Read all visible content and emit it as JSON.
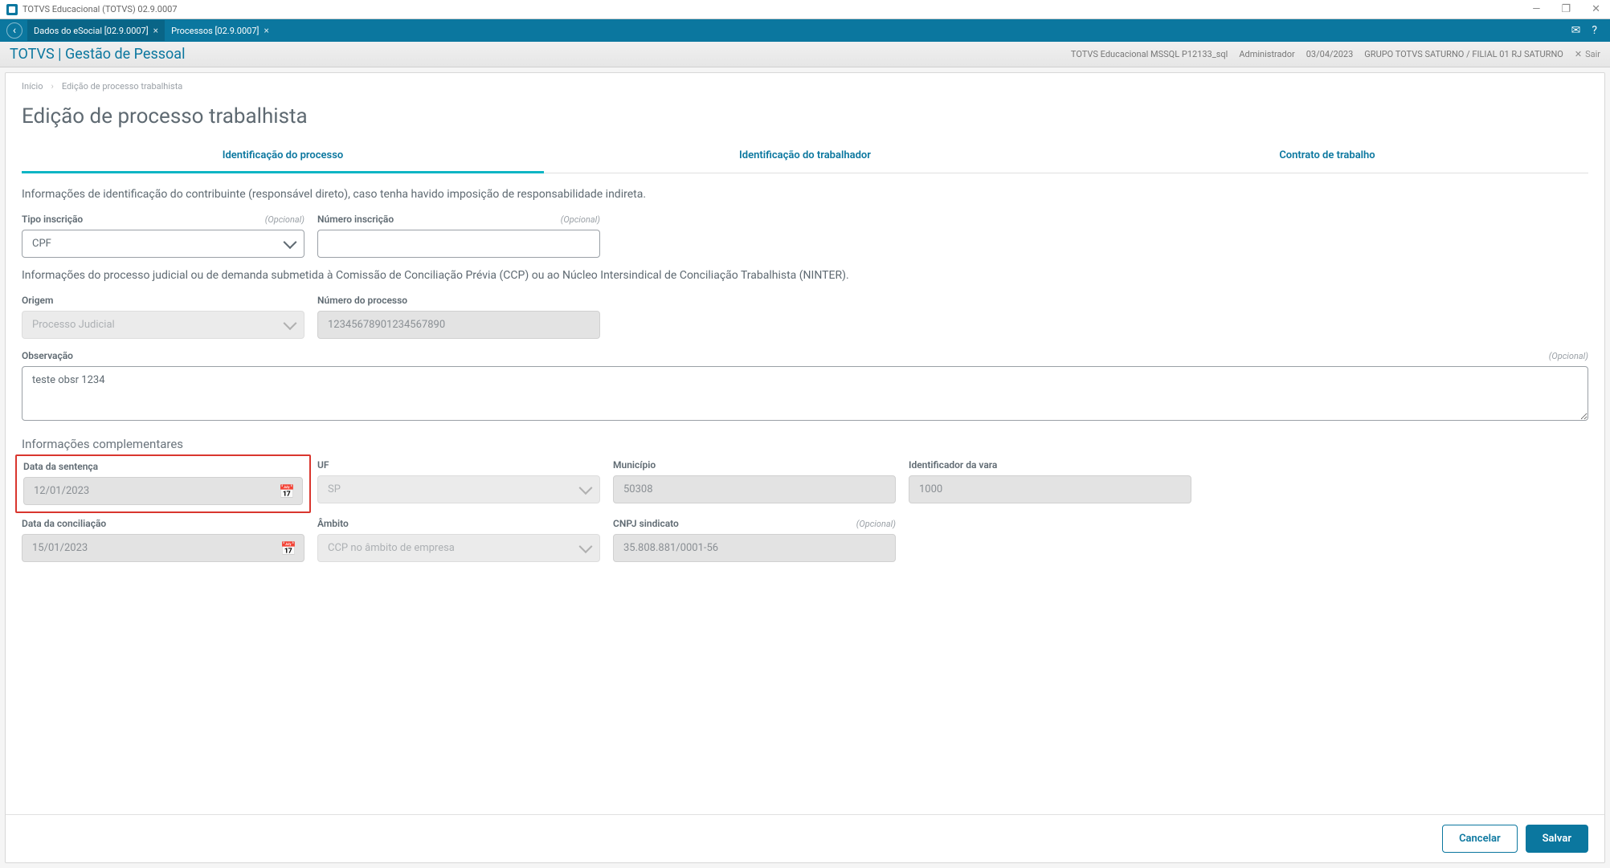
{
  "window": {
    "title": "TOTVS Educacional (TOTVS) 02.9.0007",
    "minimize": "—",
    "maximize": "❐",
    "close": "✕"
  },
  "tabbar": {
    "tabs": [
      {
        "label": "Dados do eSocial [02.9.0007]"
      },
      {
        "label": "Processos [02.9.0007]"
      }
    ]
  },
  "header": {
    "brand": "TOTVS | Gestão de Pessoal",
    "env": "TOTVS Educacional MSSQL P12133_sql",
    "user": "Administrador",
    "date": "03/04/2023",
    "company": "GRUPO TOTVS SATURNO / FILIAL 01 RJ SATURNO",
    "exit": "Sair"
  },
  "breadcrumb": {
    "home": "Início",
    "page": "Edição de processo trabalhista"
  },
  "page_title": "Edição de processo trabalhista",
  "tabs": {
    "t1": "Identificação do processo",
    "t2": "Identificação do trabalhador",
    "t3": "Contrato de trabalho"
  },
  "form": {
    "desc1": "Informações de identificação do contribuinte (responsável direto), caso tenha havido imposição de responsabilidade indireta.",
    "tipo_inscricao": {
      "label": "Tipo inscrição",
      "optional": "(Opcional)",
      "value": "CPF"
    },
    "numero_inscricao": {
      "label": "Número inscrição",
      "optional": "(Opcional)",
      "value": ""
    },
    "desc2": "Informações do processo judicial ou de demanda submetida à Comissão de Conciliação Prévia (CCP) ou ao Núcleo Intersindical de Conciliação Trabalhista (NINTER).",
    "origem": {
      "label": "Origem",
      "value": "Processo Judicial"
    },
    "numero_processo": {
      "label": "Número do processo",
      "value": "12345678901234567890"
    },
    "observacao": {
      "label": "Observação",
      "optional": "(Opcional)",
      "value": "teste obsr 1234"
    },
    "compl_title": "Informações complementares",
    "data_sentenca": {
      "label": "Data da sentença",
      "value": "12/01/2023"
    },
    "uf": {
      "label": "UF",
      "value": "SP"
    },
    "municipio": {
      "label": "Município",
      "value": "50308"
    },
    "id_vara": {
      "label": "Identificador da vara",
      "value": "1000"
    },
    "data_conciliacao": {
      "label": "Data da conciliação",
      "value": "15/01/2023"
    },
    "ambito": {
      "label": "Âmbito",
      "value": "CCP no âmbito de empresa"
    },
    "cnpj_sindicato": {
      "label": "CNPJ sindicato",
      "optional": "(Opcional)",
      "value": "35.808.881/0001-56"
    }
  },
  "footer": {
    "cancel": "Cancelar",
    "save": "Salvar"
  }
}
